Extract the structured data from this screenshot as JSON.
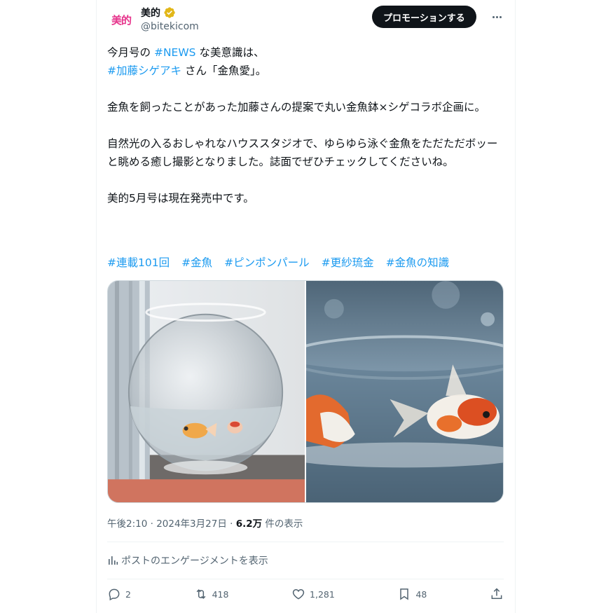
{
  "account": {
    "display_name": "美的",
    "handle": "@bitekicom",
    "avatar_text": "美的",
    "avatar_color": "#e6338b",
    "verified_color": "#e2b719"
  },
  "header": {
    "promo_label": "プロモーションする"
  },
  "post": {
    "line1_a": "今月号の",
    "line1_tag": "#NEWS",
    "line1_b": "な美意識は、",
    "line2_tag": "#加藤シゲアキ",
    "line2_b": "さん「金魚愛」。",
    "para2": "金魚を飼ったことがあった加藤さんの提案で丸い金魚鉢×シゲコラボ企画に。",
    "para3": "自然光の入るおしゃれなハウススタジオで、ゆらゆら泳ぐ金魚をただただボッーと眺める癒し撮影となりました。誌面でぜひチェックしてくださいね。",
    "para4": "美的5月号は現在発売中です。",
    "hashtags": [
      "#連載101回",
      "#金魚",
      "#ピンポンパール",
      "#更紗琉金",
      "#金魚の知識"
    ]
  },
  "meta": {
    "time": "午後2:10 · 2024年3月27日 · ",
    "views_count": "6.2万",
    "views_label": " 件の表示"
  },
  "analytics_label": "ポストのエンゲージメントを表示",
  "actions": {
    "replies": "2",
    "reposts": "418",
    "likes": "1,281",
    "bookmarks": "48"
  },
  "colors": {
    "link": "#1d9bf0",
    "text": "#0f1419",
    "muted": "#536471"
  }
}
